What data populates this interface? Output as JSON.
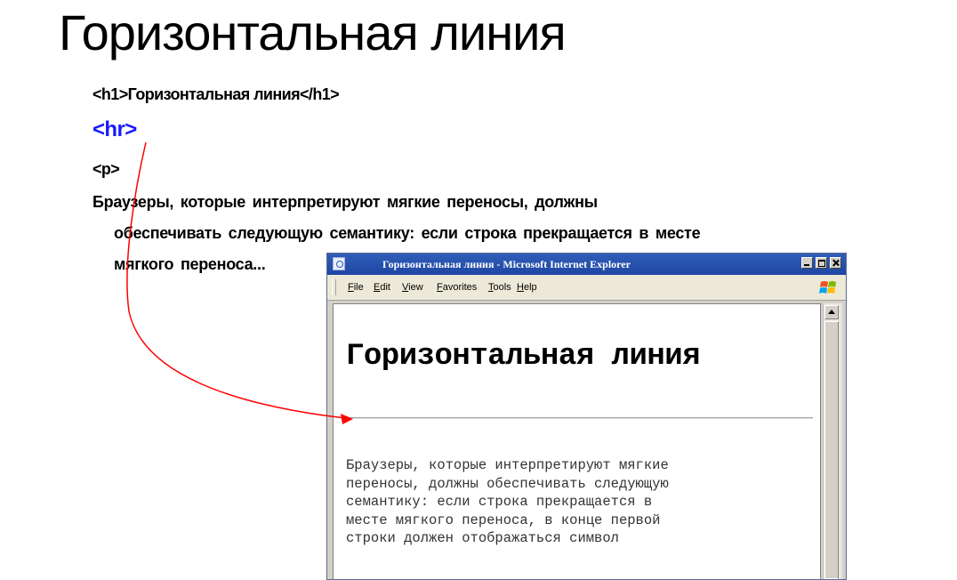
{
  "slide": {
    "title": "Горизонтальная линия",
    "code_h1": "<h1>Горизонтальная линия</h1>",
    "code_hr": "<hr>",
    "code_p": "<p>",
    "paragraph_lines": [
      "Браузеры, которые интерпретируют мягкие переносы, должны",
      "обеспечивать следующую семантику: если строка прекращается  в месте",
      "мягкого переноса..."
    ],
    "arrow_color": "#ff0000"
  },
  "browser": {
    "title": "Горизонтальная линия - Microsoft Internet Explorer",
    "menu": [
      "File",
      "Edit",
      "View",
      "Favorites",
      "Tools",
      "Help"
    ],
    "page_heading": "Горизонтальная линия",
    "page_paragraph_lines": [
      "Браузеры, которые интерпретируют мягкие",
      "переносы, должны обеспечивать следующую",
      "семантику: если строка прекращается в",
      "месте мягкого переноса, в конце первой",
      "строки должен отображаться символ"
    ],
    "titlebar_color": "#1f46a3"
  }
}
